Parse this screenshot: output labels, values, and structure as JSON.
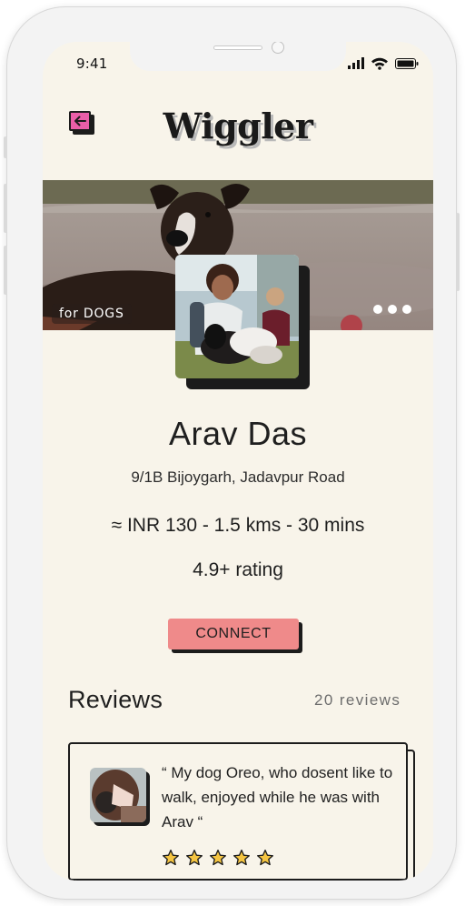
{
  "status_bar": {
    "time": "9:41",
    "icons": [
      "signal-icon",
      "wifi-icon",
      "battery-icon"
    ]
  },
  "header": {
    "title": "Wiggler",
    "back_icon": "arrow-left-icon"
  },
  "hero": {
    "tag": "for DOGS",
    "carousel_dots": 3
  },
  "profile": {
    "name": "Arav Das",
    "address": "9/1B Bijoygarh, Jadavpur Road",
    "metrics": "≈ INR 130  -  1.5 kms  -  30 mins",
    "rating": "4.9+ rating",
    "connect_label": "CONNECT"
  },
  "reviews": {
    "title": "Reviews",
    "count": "20 reviews",
    "items": [
      {
        "text": "“ My dog Oreo, who dosent like to walk, enjoyed while he was with Arav “",
        "stars": 5
      }
    ]
  },
  "colors": {
    "background": "#f8f4ea",
    "accent_pink": "#ea5ea8",
    "connect_button": "#ef8a8a",
    "star": "#f5c542",
    "ink": "#1c1c1c"
  }
}
